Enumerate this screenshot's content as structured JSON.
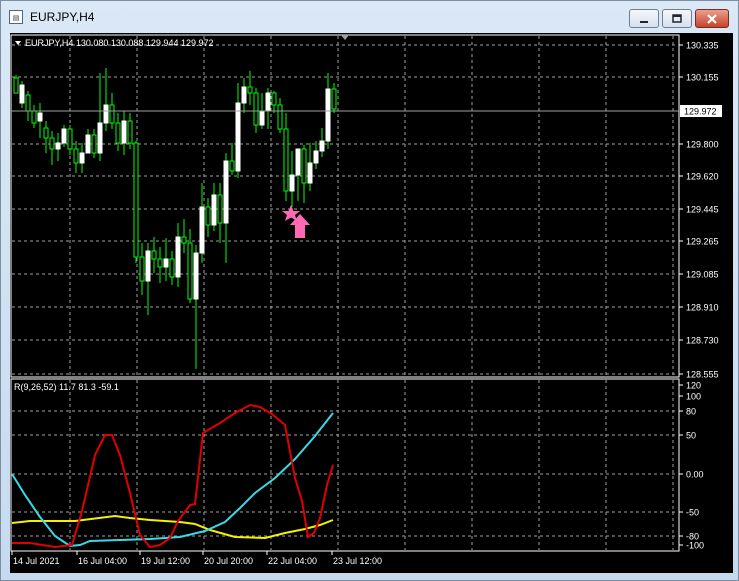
{
  "window": {
    "title": "EURJPY,H4",
    "min_icon": "minimize-icon",
    "max_icon": "maximize-icon",
    "close_icon": "close-icon"
  },
  "main_chart": {
    "header": "EURJPY,H4  130.080 130.088 129.944 129.972",
    "current_price_label": "129.972",
    "price_ticks": [
      "130.335",
      "130.155",
      "129.800",
      "129.620",
      "129.445",
      "129.265",
      "129.085",
      "128.910",
      "128.730",
      "128.555"
    ],
    "markers": [
      "star-marker-icon",
      "buy-arrow-icon"
    ]
  },
  "indicator": {
    "header": "R(9,26,52) 11.7 81.3 -59.1",
    "ticks": [
      "120",
      "100",
      "80",
      "50",
      "0.00",
      "-50",
      "-80",
      "-100"
    ]
  },
  "time_axis": {
    "labels": [
      "14 Jul 2021",
      "16 Jul 04:00",
      "19 Jul 12:00",
      "20 Jul 20:00",
      "22 Jul 04:00",
      "23 Jul 12:00"
    ]
  },
  "colors": {
    "bull_candle": "#ffffff",
    "bear_candle": "#00ff00",
    "wick": "#00ff00",
    "grid": "#a0a0a0",
    "current_price_line": "#a0a0a0",
    "marker": "#ff69b4",
    "red_line": "#e00000",
    "cyan_line": "#3ad9e6",
    "yellow_line": "#f5f000"
  }
}
